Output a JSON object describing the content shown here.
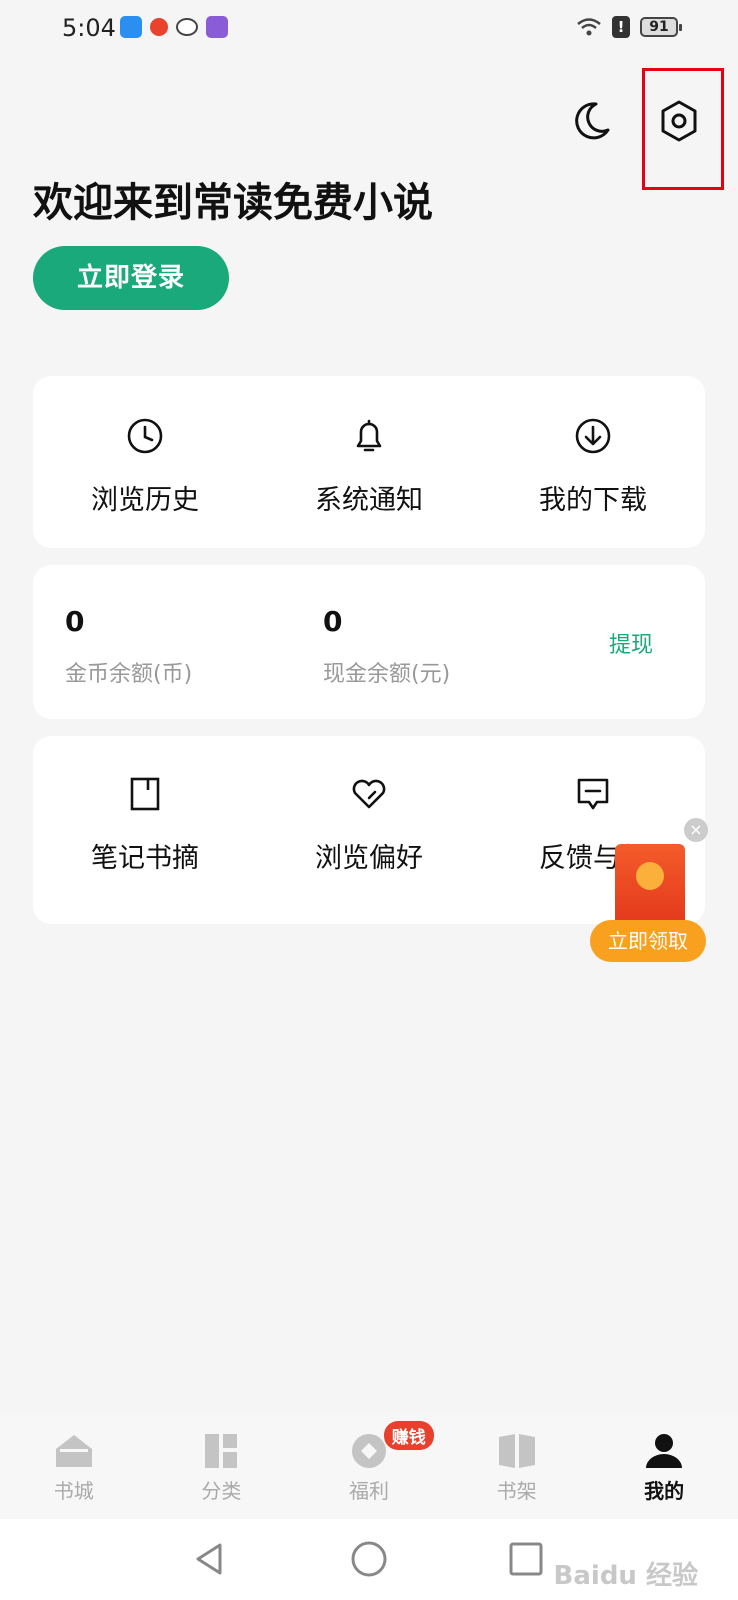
{
  "status_bar": {
    "time": "5:04",
    "battery": "91"
  },
  "header": {
    "welcome_title": "欢迎来到常读免费小说",
    "login_button": "立即登录"
  },
  "quick_actions": [
    {
      "label": "浏览历史",
      "icon": "clock-icon"
    },
    {
      "label": "系统通知",
      "icon": "bell-icon"
    },
    {
      "label": "我的下载",
      "icon": "download-icon"
    }
  ],
  "balance": {
    "coin_value": "0",
    "coin_label": "金币余额(币)",
    "cash_value": "0",
    "cash_label": "现金余额(元)",
    "withdraw": "提现"
  },
  "tools": [
    {
      "label": "笔记书摘",
      "icon": "bookmark-icon"
    },
    {
      "label": "浏览偏好",
      "icon": "heart-icon"
    },
    {
      "label": "反馈与帮",
      "icon": "feedback-icon"
    }
  ],
  "red_packet": {
    "button": "立即领取"
  },
  "bottom_nav": [
    {
      "label": "书城",
      "icon": "home-icon"
    },
    {
      "label": "分类",
      "icon": "category-icon"
    },
    {
      "label": "福利",
      "icon": "welfare-icon",
      "badge": "赚钱"
    },
    {
      "label": "书架",
      "icon": "bookshelf-icon"
    },
    {
      "label": "我的",
      "icon": "profile-icon",
      "active": true
    }
  ],
  "watermark": "Baidu 经验",
  "colors": {
    "accent": "#1aa97a",
    "highlight": "#e60012",
    "badge": "#e8402c"
  }
}
